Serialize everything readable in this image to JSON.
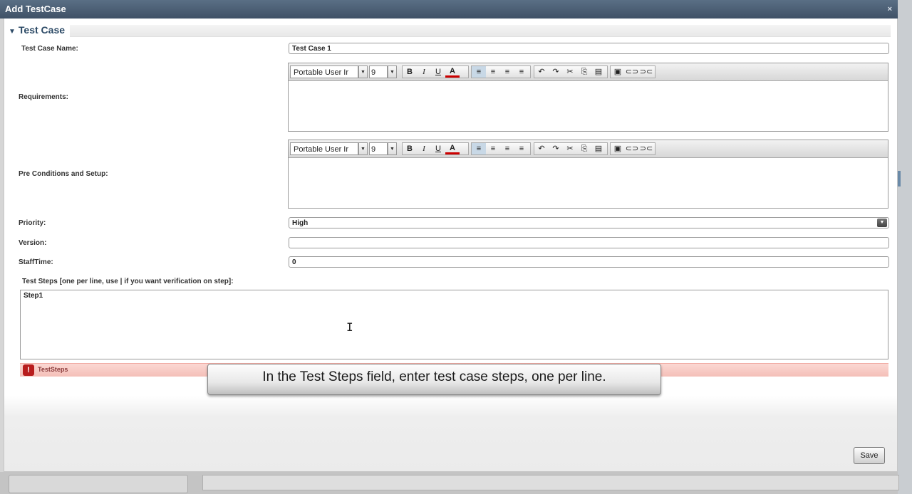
{
  "window": {
    "title": "Add TestCase",
    "close_icon": "×"
  },
  "section": {
    "title": "Test Case"
  },
  "fields": {
    "name": {
      "label": "Test Case Name:",
      "value": "Test Case 1"
    },
    "requirements": {
      "label": "Requirements:"
    },
    "preconditions": {
      "label": "Pre Conditions and Setup:"
    },
    "priority": {
      "label": "Priority:",
      "value": "High"
    },
    "version": {
      "label": "Version:",
      "value": ""
    },
    "stafftime": {
      "label": "StaffTime:",
      "value": "0"
    },
    "teststeps": {
      "label": "Test Steps [one per line, use | if you want verification on step]:",
      "value": "Step1"
    }
  },
  "editor_toolbar": {
    "font": "Portable User Ir",
    "size": "9",
    "bold": "B",
    "italic": "I",
    "underline": "U",
    "color": "A",
    "undo": "↶",
    "redo": "↷",
    "cut": "✂",
    "copy": "⎘",
    "paste": "📋"
  },
  "error": {
    "text": "TestSteps",
    "icon": "!"
  },
  "caption": "In the Test Steps field, enter test case steps, one per line.",
  "buttons": {
    "save": "Save"
  }
}
